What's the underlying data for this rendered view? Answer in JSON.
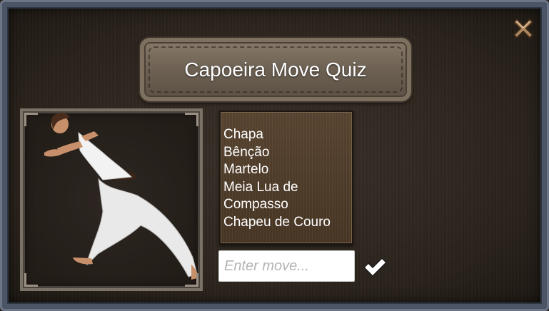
{
  "dialog": {
    "title": "Capoeira Move Quiz",
    "close_icon": "close-x-icon"
  },
  "moves": {
    "items": [
      "Chapa",
      "Bênção",
      "Martelo",
      "Meia Lua de",
      "Compasso",
      "Chapeu de Couro"
    ]
  },
  "answer": {
    "value": "",
    "placeholder": "Enter move...",
    "submit_icon": "checkmark-icon"
  },
  "colors": {
    "frame": "#4b5566",
    "wood_panel": "#4e3c2a",
    "title_plate": "#6d6153",
    "text": "#ffffff"
  }
}
